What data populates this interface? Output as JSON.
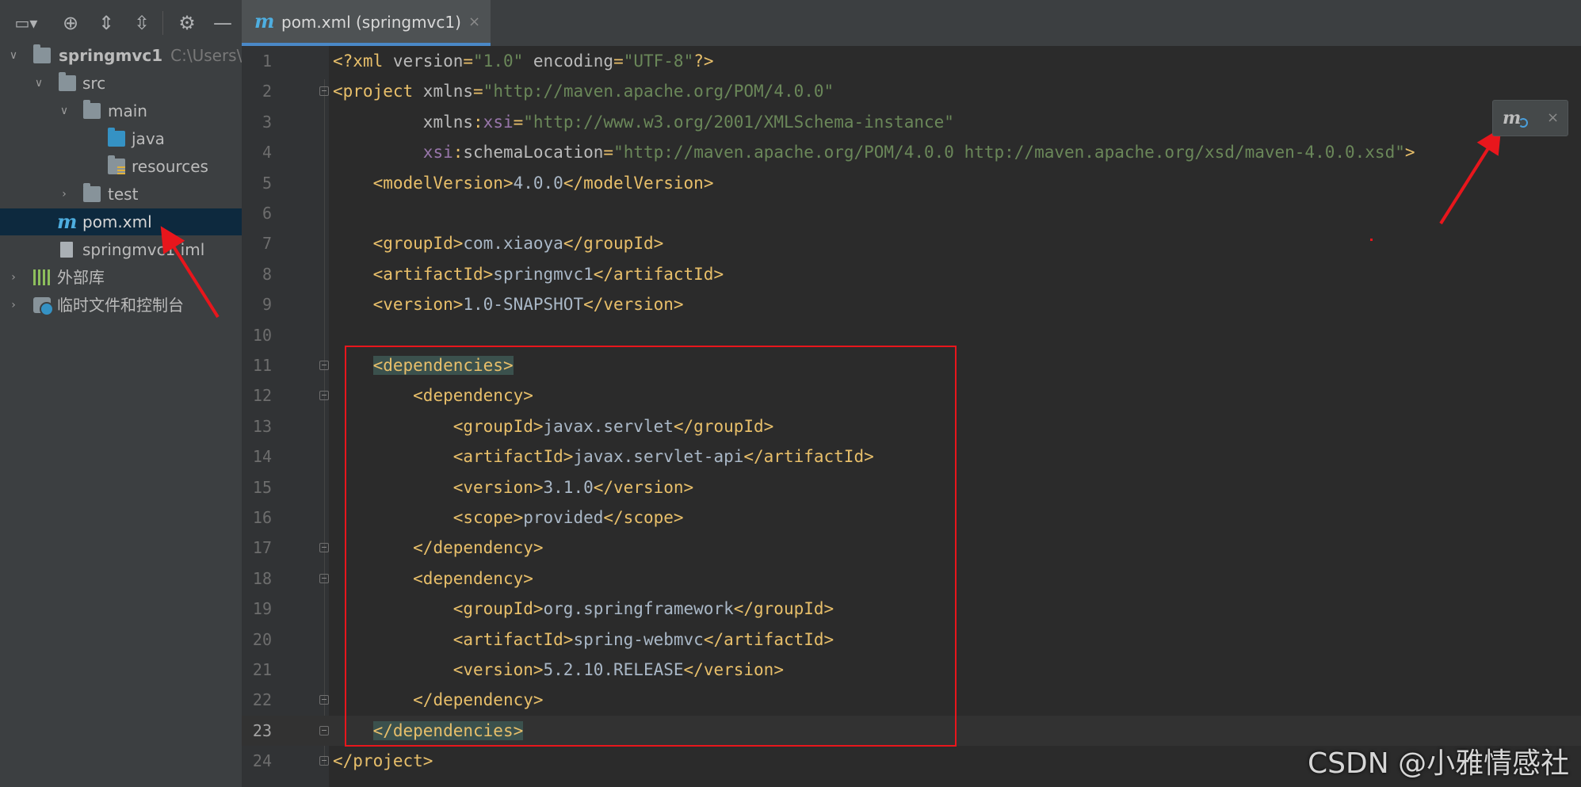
{
  "project_panel": {
    "toolbar_icons": [
      "project-view-icon",
      "locate-icon",
      "expand-all-icon",
      "collapse-all-icon",
      "gear-icon",
      "minimize-icon"
    ],
    "tree": [
      {
        "label": "springmvc1",
        "hint": "C:\\Users\\",
        "icon": "module-folder-icon",
        "expanded": true
      },
      {
        "label": "src",
        "icon": "folder-icon",
        "expanded": true
      },
      {
        "label": "main",
        "icon": "folder-icon",
        "expanded": true
      },
      {
        "label": "java",
        "icon": "source-folder-icon"
      },
      {
        "label": "resources",
        "icon": "resources-folder-icon"
      },
      {
        "label": "test",
        "icon": "folder-icon",
        "expanded": false
      },
      {
        "label": "pom.xml",
        "icon": "maven-icon",
        "selected": true
      },
      {
        "label": "springmvc1.iml",
        "icon": "iml-file-icon"
      },
      {
        "label": "外部库",
        "icon": "library-icon",
        "expanded": false
      },
      {
        "label": "临时文件和控制台",
        "icon": "scratch-icon",
        "expanded": false
      }
    ]
  },
  "editor": {
    "tab": {
      "label": "pom.xml (springmvc1)",
      "close": "×"
    },
    "current_line": 23,
    "lines": [
      {
        "n": "1",
        "segs": [
          [
            "t-tag",
            "<?xml "
          ],
          [
            "t-attr",
            "version"
          ],
          [
            "t-tag",
            "="
          ],
          [
            "t-val",
            "\"1.0\""
          ],
          [
            "t-tag",
            " "
          ],
          [
            "t-attr",
            "encoding"
          ],
          [
            "t-tag",
            "="
          ],
          [
            "t-val",
            "\"UTF-8\""
          ],
          [
            "t-tag",
            "?>"
          ]
        ]
      },
      {
        "n": "2",
        "segs": [
          [
            "t-tag",
            "<project "
          ],
          [
            "t-attr",
            "xmlns"
          ],
          [
            "t-tag",
            "="
          ],
          [
            "t-val",
            "\"http://maven.apache.org/POM/4.0.0\""
          ]
        ]
      },
      {
        "n": "3",
        "segs": [
          [
            "t-tag",
            "         "
          ],
          [
            "t-attr",
            "xmlns"
          ],
          [
            "t-tag",
            ":"
          ],
          [
            "t-ns",
            "xsi"
          ],
          [
            "t-tag",
            "="
          ],
          [
            "t-val",
            "\"http://www.w3.org/2001/XMLSchema-instance\""
          ]
        ]
      },
      {
        "n": "4",
        "segs": [
          [
            "t-tag",
            "         "
          ],
          [
            "t-ns",
            "xsi"
          ],
          [
            "t-tag",
            ":"
          ],
          [
            "t-attr",
            "schemaLocation"
          ],
          [
            "t-tag",
            "="
          ],
          [
            "t-val",
            "\"http://maven.apache.org/POM/4.0.0 http://maven.apache.org/xsd/maven-4.0.0.xsd\""
          ],
          [
            "t-tag",
            ">"
          ]
        ]
      },
      {
        "n": "5",
        "segs": [
          [
            "t-text",
            "    "
          ],
          [
            "t-tag",
            "<modelVersion>"
          ],
          [
            "t-text",
            "4.0.0"
          ],
          [
            "t-tag",
            "</modelVersion>"
          ]
        ]
      },
      {
        "n": "6",
        "segs": []
      },
      {
        "n": "7",
        "segs": [
          [
            "t-text",
            "    "
          ],
          [
            "t-tag",
            "<groupId>"
          ],
          [
            "t-text",
            "com.xiaoya"
          ],
          [
            "t-tag",
            "</groupId>"
          ]
        ]
      },
      {
        "n": "8",
        "segs": [
          [
            "t-text",
            "    "
          ],
          [
            "t-tag",
            "<artifactId>"
          ],
          [
            "t-text",
            "springmvc1"
          ],
          [
            "t-tag",
            "</artifactId>"
          ]
        ]
      },
      {
        "n": "9",
        "segs": [
          [
            "t-text",
            "    "
          ],
          [
            "t-tag",
            "<version>"
          ],
          [
            "t-text",
            "1.0-SNAPSHOT"
          ],
          [
            "t-tag",
            "</version>"
          ]
        ]
      },
      {
        "n": "10",
        "segs": []
      },
      {
        "n": "11",
        "segs": [
          [
            "t-text",
            "    "
          ],
          [
            "t-tag hl",
            "<dependencies>"
          ]
        ]
      },
      {
        "n": "12",
        "segs": [
          [
            "t-text",
            "        "
          ],
          [
            "t-tag",
            "<dependency>"
          ]
        ]
      },
      {
        "n": "13",
        "segs": [
          [
            "t-text",
            "            "
          ],
          [
            "t-tag",
            "<groupId>"
          ],
          [
            "t-text",
            "javax.servlet"
          ],
          [
            "t-tag",
            "</groupId>"
          ]
        ]
      },
      {
        "n": "14",
        "segs": [
          [
            "t-text",
            "            "
          ],
          [
            "t-tag",
            "<artifactId>"
          ],
          [
            "t-text",
            "javax.servlet-api"
          ],
          [
            "t-tag",
            "</artifactId>"
          ]
        ]
      },
      {
        "n": "15",
        "segs": [
          [
            "t-text",
            "            "
          ],
          [
            "t-tag",
            "<version>"
          ],
          [
            "t-text",
            "3.1.0"
          ],
          [
            "t-tag",
            "</version>"
          ]
        ]
      },
      {
        "n": "16",
        "segs": [
          [
            "t-text",
            "            "
          ],
          [
            "t-tag",
            "<scope>"
          ],
          [
            "t-text",
            "provided"
          ],
          [
            "t-tag",
            "</scope>"
          ]
        ]
      },
      {
        "n": "17",
        "segs": [
          [
            "t-text",
            "        "
          ],
          [
            "t-tag",
            "</dependency>"
          ]
        ]
      },
      {
        "n": "18",
        "segs": [
          [
            "t-text",
            "        "
          ],
          [
            "t-tag",
            "<dependency>"
          ]
        ]
      },
      {
        "n": "19",
        "segs": [
          [
            "t-text",
            "            "
          ],
          [
            "t-tag",
            "<groupId>"
          ],
          [
            "t-text",
            "org.springframework"
          ],
          [
            "t-tag",
            "</groupId>"
          ]
        ]
      },
      {
        "n": "20",
        "segs": [
          [
            "t-text",
            "            "
          ],
          [
            "t-tag",
            "<artifactId>"
          ],
          [
            "t-text",
            "spring-webmvc"
          ],
          [
            "t-tag",
            "</artifactId>"
          ]
        ]
      },
      {
        "n": "21",
        "segs": [
          [
            "t-text",
            "            "
          ],
          [
            "t-tag",
            "<version>"
          ],
          [
            "t-text",
            "5.2.10.RELEASE"
          ],
          [
            "t-tag",
            "</version>"
          ]
        ]
      },
      {
        "n": "22",
        "segs": [
          [
            "t-text",
            "        "
          ],
          [
            "t-tag",
            "</dependency>"
          ]
        ]
      },
      {
        "n": "23",
        "segs": [
          [
            "t-text",
            "    "
          ],
          [
            "t-tag hl",
            "</dependencies>"
          ]
        ]
      },
      {
        "n": "24",
        "segs": [
          [
            "t-tag",
            "</project>"
          ]
        ]
      }
    ]
  },
  "maven_reload_popup": {
    "icon": "maven-reload-icon",
    "close": "×"
  },
  "watermark": "CSDN @小雅情感社",
  "colors": {
    "annotation_red": "#e8161c",
    "tag": "#e8bf6a",
    "string": "#6a8759",
    "namespace": "#9876aa",
    "selection": "#0d293e"
  }
}
